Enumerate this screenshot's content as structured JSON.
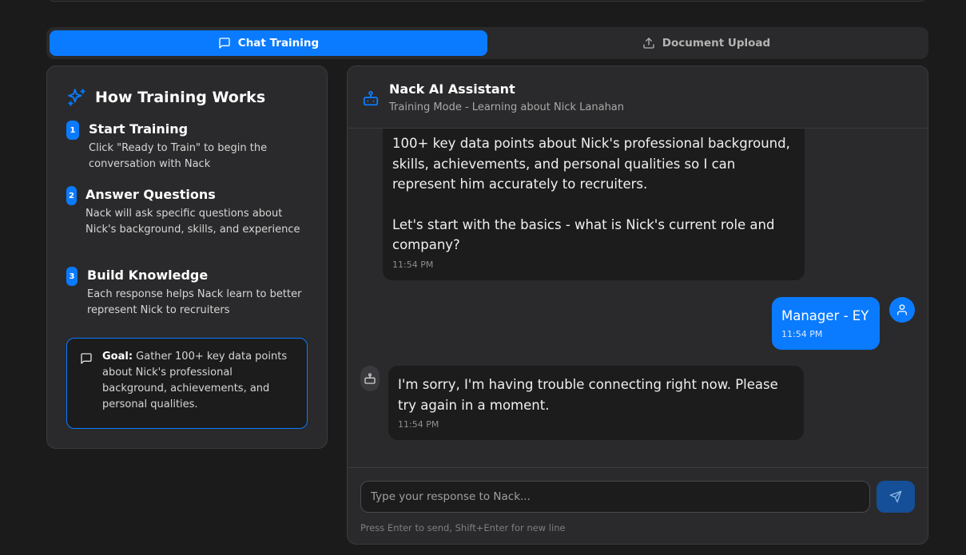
{
  "tabs": [
    {
      "label": "Chat Training",
      "icon": "message-square-icon",
      "active": true
    },
    {
      "label": "Document Upload",
      "icon": "upload-icon",
      "active": false
    }
  ],
  "training_info": {
    "title": "How Training Works",
    "steps": [
      {
        "number": "1",
        "title": "Start Training",
        "description": "Click \"Ready to Train\" to begin the conversation with Nack"
      },
      {
        "number": "2",
        "title": "Answer Questions",
        "description": "Nack will ask specific questions about Nick's background, skills, and experience"
      },
      {
        "number": "3",
        "title": "Build Knowledge",
        "description": "Each response helps Nack learn to better represent Nick to recruiters"
      }
    ],
    "goal_label": "Goal:",
    "goal_text": "Gather 100+ key data points about Nick's professional background, achievements, and personal qualities."
  },
  "chat": {
    "assistant_name": "Nack AI Assistant",
    "mode": "Training Mode - Learning about Nick Lanahan",
    "messages": [
      {
        "sender": "assistant",
        "line1": "100+ key data points about Nick's professional background, skills, achievements, and personal qualities so I can represent him accurately to recruiters.",
        "line2": "Let's start with the basics - what is Nick's current role and company?",
        "time": "11:54 PM"
      },
      {
        "sender": "user",
        "text": "Manager - EY",
        "time": "11:54 PM"
      },
      {
        "sender": "assistant",
        "text": "I'm sorry, I'm having trouble connecting right now. Please try again in a moment.",
        "time": "11:54 PM"
      }
    ],
    "input_placeholder": "Type your response to Nack...",
    "hint": "Press Enter to send, Shift+Enter for new line"
  },
  "colors": {
    "accent": "#0a7bff",
    "background": "#1b1b1c",
    "panel": "#2a2a2c",
    "bubble": "#1c1c1d"
  }
}
